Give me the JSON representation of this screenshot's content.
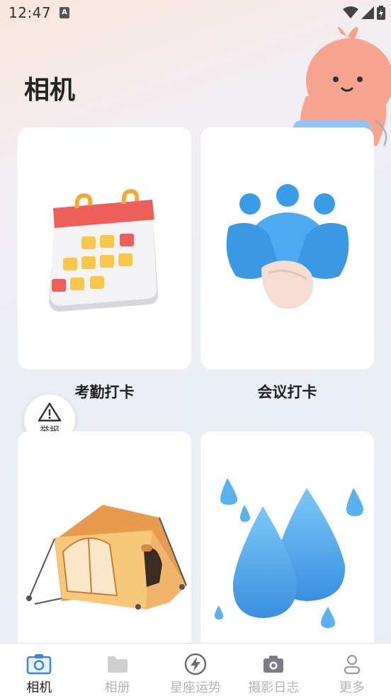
{
  "status_bar": {
    "time": "12:47",
    "notification_icon": "a-icon",
    "icons": [
      "wifi-icon",
      "signal-icon",
      "battery-icon"
    ]
  },
  "page": {
    "title": "相机"
  },
  "cards": [
    {
      "label": "考勤打卡",
      "image": "calendar-illustration"
    },
    {
      "label": "会议打卡",
      "image": "handshake-illustration"
    },
    {
      "label": "",
      "image": "tent-illustration"
    },
    {
      "label": "",
      "image": "water-drops-illustration"
    }
  ],
  "report": {
    "label": "举报",
    "icon": "warning-icon"
  },
  "bottom_nav": {
    "items": [
      {
        "label": "相机",
        "icon": "camera-icon",
        "active": true
      },
      {
        "label": "相册",
        "icon": "folder-icon",
        "active": false
      },
      {
        "label": "星座运势",
        "icon": "lightning-icon",
        "active": false
      },
      {
        "label": "摄影日志",
        "icon": "camera-filled-icon",
        "active": false
      },
      {
        "label": "更多",
        "icon": "user-icon",
        "active": false
      }
    ]
  },
  "colors": {
    "accent": "#3a86d6",
    "inactive": "#b5b5b5",
    "active_text": "#222222"
  }
}
